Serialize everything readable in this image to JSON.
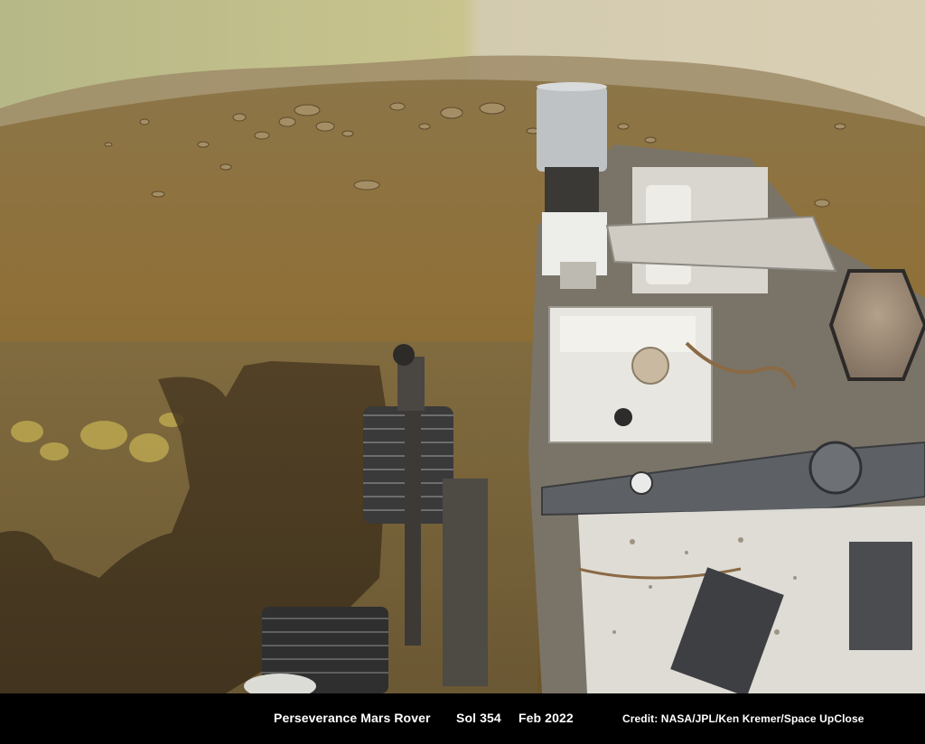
{
  "image": {
    "subject": "photo"
  },
  "caption": {
    "title": "Perseverance Mars Rover",
    "sol": "Sol 354",
    "date": "Feb 2022",
    "credit": "Credit: NASA/JPL/Ken Kremer/Space UpClose"
  },
  "colors": {
    "sky_left": "#b8b884",
    "sky_right": "#d7cdb0",
    "terrain": "#8a6f3a",
    "shadow": "#3b2c18",
    "rover_white": "#e8e6e0",
    "rover_gray": "#5b5e62",
    "caption_bg": "#000000",
    "caption_text": "#ffffff"
  }
}
